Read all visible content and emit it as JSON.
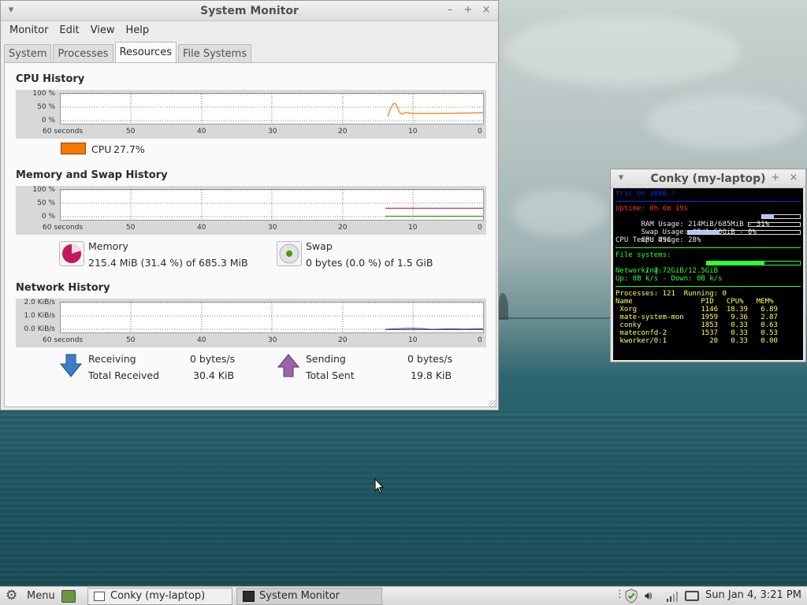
{
  "sysmon": {
    "title": "System Monitor",
    "menus": [
      "Monitor",
      "Edit",
      "View",
      "Help"
    ],
    "tabs": [
      "System",
      "Processes",
      "Resources",
      "File Systems"
    ],
    "active_tab": "Resources",
    "x_ticks": [
      "60 seconds",
      "50",
      "40",
      "30",
      "20",
      "10",
      "0"
    ],
    "cpu": {
      "title": "CPU History",
      "y_ticks": [
        "100 %",
        "50 %",
        "0 %"
      ],
      "legend_label": "CPU",
      "legend_value": "27.7%",
      "color": "#f57900"
    },
    "memory": {
      "title": "Memory and Swap History",
      "y_ticks": [
        "100 %",
        "50 %",
        "0 %"
      ],
      "mem_label": "Memory",
      "mem_value": "215.4 MiB (31.4 %) of 685.3 MiB",
      "swap_label": "Swap",
      "swap_value": "0 bytes (0.0 %) of 1.5 GiB",
      "mem_color": "#c0195e",
      "swap_color": "#4e9a06",
      "memory_percent": 31.4,
      "swap_percent": 0.0
    },
    "network": {
      "title": "Network History",
      "y_ticks": [
        "2.0 KiB/s",
        "1.0 KiB/s",
        "0.0 KiB/s"
      ],
      "receiving_label": "Receiving",
      "receiving_value": "0 bytes/s",
      "total_received_label": "Total Received",
      "total_received_value": "30.4 KiB",
      "sending_label": "Sending",
      "sending_value": "0 bytes/s",
      "total_sent_label": "Total Sent",
      "total_sent_value": "19.8 KiB",
      "receiving_color": "#3465a4",
      "sending_color": "#75507b"
    }
  },
  "conky": {
    "title": "Conky (my-laptop)",
    "header": "tric on i686 !",
    "uptime": "Uptime: 0h 6m 19s",
    "ram": "RAM Usage: 214MiB/685MiB - 31%",
    "ram_percent": 31,
    "swap": "Swap Usage: 0B/1.50GiB - 0%",
    "swap_percent": 0,
    "cpu": "CPU Usage: 28%",
    "cpu_percent": 28,
    "cpu_temp": "CPU Temp: 49C",
    "fs_title": "File systems:",
    "fs_root": " / 7.72GiB/12.5GiB",
    "fs_percent": 62,
    "net_title": "Networking:",
    "net_line": "Up: 0B k/s - Down: 0B k/s",
    "processes": "Processes: 121  Running: 0",
    "proc_header": "Name                PID   CPU%   MEM%",
    "proc_rows": [
      " Xorg               1146  18.39   6.89",
      " mate-system-mon    1959   9.36   2.87",
      " conky              1853   0.33   0.63",
      " mateconfd-2        1537   0.33   0.53",
      " kworker/0:1          20   0.33   0.00"
    ]
  },
  "taskbar": {
    "menu_label": "Menu",
    "tasks": [
      "Conky (my-laptop)",
      "System Monitor"
    ],
    "clock": "Sun Jan  4,  3:21 PM"
  }
}
